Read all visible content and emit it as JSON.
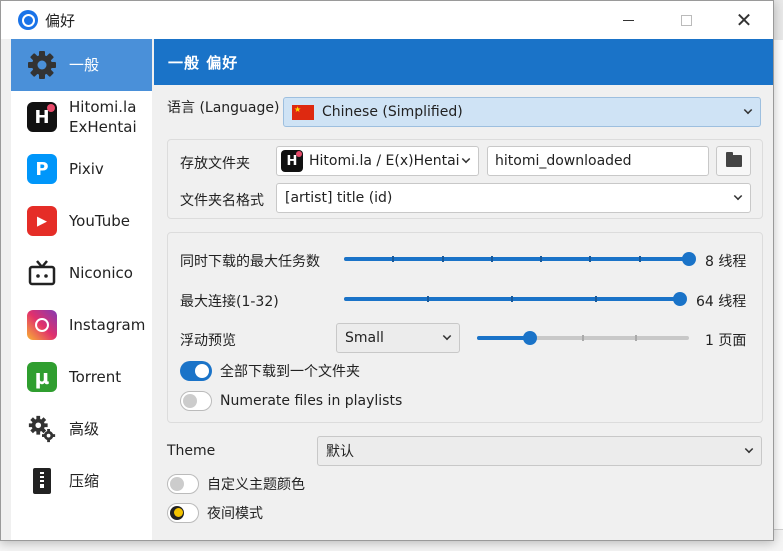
{
  "window": {
    "title": "偏好"
  },
  "sidebar": {
    "items": [
      {
        "label": "一般",
        "icon": "gear-icon",
        "active": true
      },
      {
        "label": "Hitomi.la\nExHentai",
        "icon": "hitomi-icon",
        "line1": "Hitomi.la",
        "line2": "ExHentai"
      },
      {
        "label": "Pixiv",
        "icon": "pixiv-icon"
      },
      {
        "label": "YouTube",
        "icon": "youtube-icon"
      },
      {
        "label": "Niconico",
        "icon": "niconico-icon"
      },
      {
        "label": "Instagram",
        "icon": "instagram-icon"
      },
      {
        "label": "Torrent",
        "icon": "utorrent-icon"
      },
      {
        "label": "高级",
        "icon": "gears-icon"
      },
      {
        "label": "压缩",
        "icon": "zip-icon"
      }
    ]
  },
  "header": {
    "title": "一般 偏好"
  },
  "language": {
    "label": "语言 (Language)",
    "value": "Chinese (Simplified)",
    "flag": "cn-flag"
  },
  "storage": {
    "folder_label": "存放文件夹",
    "site_select": "Hitomi.la / E(x)Hentai",
    "folder_value": "hitomi_downloaded",
    "format_label": "文件夹名格式",
    "format_value": "[artist] title (id)"
  },
  "limits": {
    "max_tasks_label": "同时下载的最大任务数",
    "max_tasks_value": "8",
    "max_tasks_unit": "线程",
    "max_tasks_fraction": 1.0,
    "max_conn_label": "最大连接(1-32)",
    "max_conn_value": "64",
    "max_conn_unit": "线程",
    "max_conn_fraction": 1.0,
    "preview_label": "浮动预览",
    "preview_size": "Small",
    "preview_pages_value": "1",
    "preview_pages_unit": "页面",
    "preview_fraction": 0.25,
    "all_in_one_label": "全部下载到一个文件夹",
    "all_in_one_on": true,
    "numerate_label": "Numerate files in playlists",
    "numerate_on": false
  },
  "theme": {
    "label": "Theme",
    "value": "默认",
    "custom_color_label": "自定义主题颜色",
    "night_label": "夜间模式"
  },
  "colors": {
    "accent": "#1a73c8",
    "sidebar_active": "#4a90d9"
  }
}
